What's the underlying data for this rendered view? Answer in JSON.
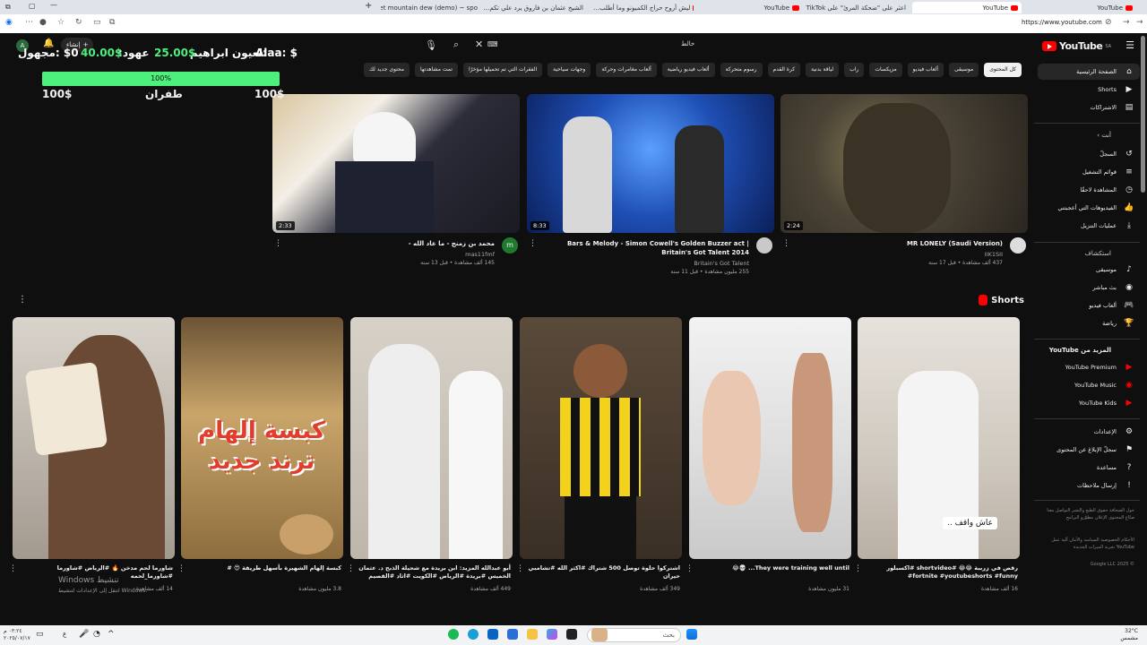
{
  "browser": {
    "tabs": [
      {
        "label": "diet mountain dew (demo) ~ spo",
        "icon": "spotify-icon",
        "active": false
      },
      {
        "label": "الشيخ عثمان بن فاروق يرد علي تكم…",
        "icon": "youtube-icon",
        "active": false
      },
      {
        "label": "ليش أروح حراج الكميونو وما أطلب…",
        "icon": "youtube-icon",
        "active": false
      },
      {
        "label": "YouTube",
        "icon": "youtube-icon",
        "active": false
      },
      {
        "label": "اعثر على \"ضحكة المرئ\" على TikTok",
        "icon": "tiktok-icon",
        "active": false
      },
      {
        "label": "YouTube",
        "icon": "youtube-icon",
        "active": true
      },
      {
        "label": "YouTube",
        "icon": "youtube-icon",
        "active": false
      }
    ],
    "url": "https://www.youtube.com"
  },
  "overlay": {
    "row1_left": "$0 :مجهول",
    "row1_mid_value": "40.00$",
    "row1_mid_label": ":عهود",
    "row1_right_value": "25.00$",
    "row1_right_label": "لعيون ابراهيم:",
    "row1_far": "Alaa: $",
    "progress_label": "100%",
    "progress_value": 1.0,
    "row2_left": "100$",
    "row2_mid": "طفران",
    "row2_right": "100$"
  },
  "search": {
    "value": "خالط",
    "clear_icon": "close-icon",
    "search_icon": "search-icon",
    "mic_icon": "mic-icon"
  },
  "header": {
    "create_label": "إنشاء",
    "avatar_letter": "A"
  },
  "chips": [
    {
      "label": "كل المحتوى",
      "selected": true
    },
    {
      "label": "موسيقى",
      "selected": false
    },
    {
      "label": "ألعاب فيديو",
      "selected": false
    },
    {
      "label": "مزيكسات",
      "selected": false
    },
    {
      "label": "راب",
      "selected": false
    },
    {
      "label": "لياقة بدنية",
      "selected": false
    },
    {
      "label": "كرة القدم",
      "selected": false
    },
    {
      "label": "رسوم متحركة",
      "selected": false
    },
    {
      "label": "ألعاب فيديو رياضية",
      "selected": false
    },
    {
      "label": "ألعاب مغامرات وحركة",
      "selected": false
    },
    {
      "label": "وجهات سياحية",
      "selected": false
    },
    {
      "label": "الفقرات التي تم تحميلها مؤخرًا",
      "selected": false
    },
    {
      "label": "تمت مشاهدتها",
      "selected": false
    },
    {
      "label": "محتوى جديد لك",
      "selected": false
    }
  ],
  "sidebar": {
    "logo_text": "YouTube",
    "logo_region": "SA",
    "main": [
      {
        "label": "الصفحة الرئيسية",
        "icon": "home-icon"
      },
      {
        "label": "Shorts",
        "icon": "shorts-icon"
      },
      {
        "label": "الاشتراكات",
        "icon": "subscriptions-icon"
      }
    ],
    "you_header": "أنت",
    "you": [
      {
        "label": "السجلّ",
        "icon": "history-icon"
      },
      {
        "label": "قوائم التشغيل",
        "icon": "playlist-icon"
      },
      {
        "label": "المشاهدة لاحقًا",
        "icon": "clock-icon"
      },
      {
        "label": "الفيديوهات التي أعجبتني",
        "icon": "thumbs-up-icon"
      },
      {
        "label": "عمليات التنزيل",
        "icon": "download-icon"
      }
    ],
    "explore_header": "استكشاف",
    "explore": [
      {
        "label": "موسيقى",
        "icon": "music-icon"
      },
      {
        "label": "بث مباشر",
        "icon": "live-icon"
      },
      {
        "label": "ألعاب فيديو",
        "icon": "gaming-icon"
      },
      {
        "label": "رياضة",
        "icon": "trophy-icon"
      }
    ],
    "more_header": "المزيد من YouTube",
    "more": [
      {
        "label": "YouTube Premium",
        "icon": "youtube-premium-icon"
      },
      {
        "label": "YouTube Music",
        "icon": "youtube-music-icon"
      },
      {
        "label": "YouTube Kids",
        "icon": "youtube-kids-icon"
      }
    ],
    "settings": [
      {
        "label": "الإعدادات",
        "icon": "gear-icon"
      },
      {
        "label": "سجلّ الإبلاغ عن المحتوى",
        "icon": "flag-icon"
      },
      {
        "label": "مساعدة",
        "icon": "help-icon"
      },
      {
        "label": "إرسال ملاحظات",
        "icon": "feedback-icon"
      }
    ],
    "footer1": "حول الصحافة حقوق الطبع والنشر التواصل معنا صنّاع المحتوى الإعلان مطوّرو البرامج",
    "footer2": "الأحكام الخصوصية السياسة والأمان آلية عمل YouTube تجربة الميزات الجديدة",
    "copyright": "© 2025 Google LLC"
  },
  "videos": [
    {
      "title": "محمد بن زمنج - ما عاد الله -",
      "channel": "mas11fmf",
      "meta": "145 ألف مشاهدة • قبل 13 سنة",
      "duration": "2:33",
      "avatar_letter": "m"
    },
    {
      "title": "Bars & Melody - Simon Cowell's Golden Buzzer act | Britain's Got Talent 2014",
      "channel": "Britain's Got Talent",
      "meta": "255 مليون مشاهدة • قبل 11 سنة",
      "duration": "8:33",
      "avatar_letter": ""
    },
    {
      "title": "MR LONELY (Saudi Version)",
      "channel": "IIK1SII",
      "meta": "437 ألف مشاهدة • قبل 17 سنة",
      "duration": "2:24",
      "avatar_letter": ""
    }
  ],
  "shorts_title": "Shorts",
  "shorts": [
    {
      "title": "رقص في زرببة 😂😂 #shortvideo #اكسبلور fortnite #youtubeshorts #funny#",
      "views": "16 ألف مشاهدة",
      "caption": "عاش واقف .."
    },
    {
      "title": "They were training well until... 💀😂",
      "views": "31 مليون مشاهدة",
      "caption": ""
    },
    {
      "title": "اشتركوا حلوة توصل 500 شتراك #اكثر الله #تشامبي حيران",
      "views": "349 ألف مشاهدة",
      "caption": ""
    },
    {
      "title": "أبو عبدالله المزيد: ابن بريدة مع شحيلة الذبح د. عثمان الخميس #بريدة #الرياض #الكويت #اثاد #القصيم",
      "views": "449 ألف مشاهدة",
      "caption": ""
    },
    {
      "title": "كبسة إلهام الشهيرة بأسهل طريقة 😍 #",
      "views": "3.8 مليون مشاهدة",
      "caption": "",
      "overlay": "كبسة إلهام ترند جديد"
    },
    {
      "title": "شاورما لحم مدخن 🔥 #الرياض #شاورما #شاورما_لحمه",
      "views": "14 ألف مشاهدة",
      "caption": ""
    }
  ],
  "watermark": {
    "line1": "Windows تنشيط",
    "line2": "انتقل إلى الإعدادات لتنشيط Windows."
  },
  "taskbar": {
    "search_placeholder": "بحث",
    "time": "٠٣:٢٤ م",
    "date": "٢٠٢٥/٠٧/١٧",
    "weather_temp": "32°C",
    "weather_desc": "مشمس",
    "lang": "ع"
  }
}
